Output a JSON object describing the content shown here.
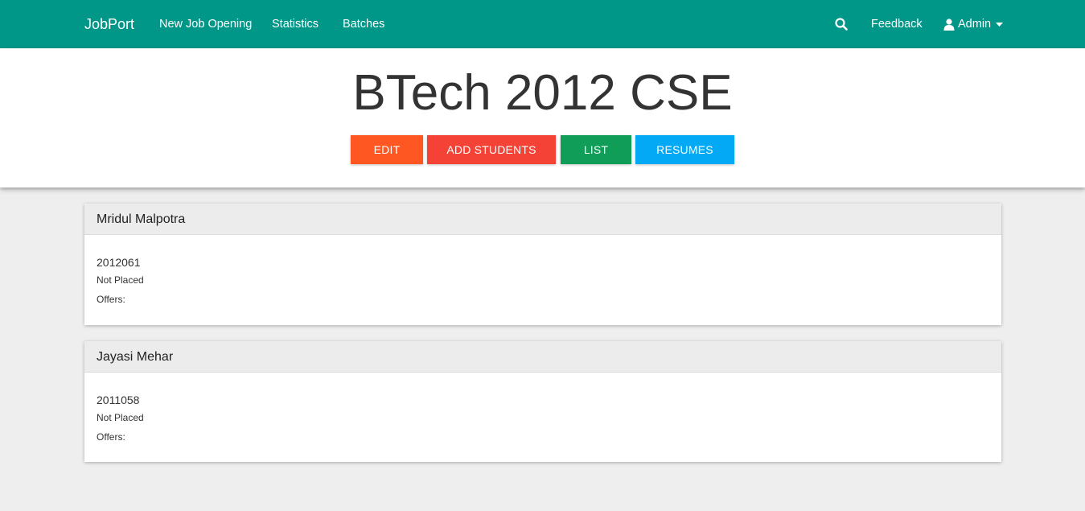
{
  "navbar": {
    "brand": "JobPort",
    "links": [
      "New Job Opening",
      "Statistics",
      "Batches"
    ],
    "search_icon": "search-icon",
    "feedback": "Feedback",
    "user_icon": "user-icon",
    "admin": "Admin",
    "caret_icon": "caret-down-icon"
  },
  "hero": {
    "title": "BTech 2012 CSE",
    "buttons": [
      {
        "label": "EDIT",
        "color": "#ff5722"
      },
      {
        "label": "ADD STUDENTS",
        "color": "#f44336"
      },
      {
        "label": "LIST",
        "color": "#0f9d58"
      },
      {
        "label": "RESUMES",
        "color": "#03a9f4"
      }
    ]
  },
  "students": [
    {
      "name": "Mridul Malpotra",
      "roll": "2012061",
      "status": "Not Placed",
      "offers": "Offers:"
    },
    {
      "name": "Jayasi Mehar",
      "roll": "2011058",
      "status": "Not Placed",
      "offers": "Offers:"
    }
  ],
  "colors": {
    "navbar": "#009688",
    "background": "#eeeeee"
  }
}
